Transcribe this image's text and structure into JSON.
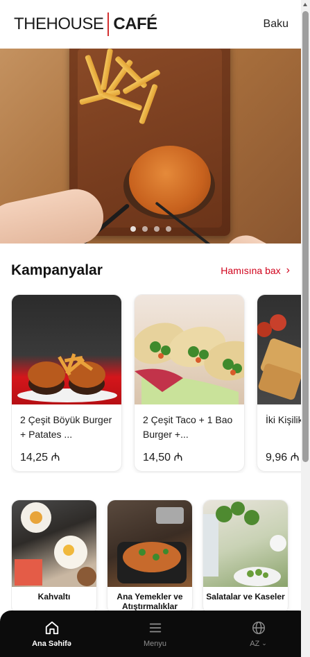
{
  "header": {
    "logo_part1": "THEHOUSE",
    "logo_part2": "CAFÉ",
    "city": "Baku"
  },
  "hero": {
    "slides": 4,
    "active_slide": 1
  },
  "campaigns": {
    "title": "Kampanyalar",
    "see_all": "Hamısına bax",
    "items": [
      {
        "name": "2 Çeşit Böyük Burger + Patates ...",
        "price": "14,25 ₼"
      },
      {
        "name": "2 Çeşit Taco + 1 Bao Burger +...",
        "price": "14,50 ₼"
      },
      {
        "name": "İki Kişilik Tabağı",
        "price": "9,96 ₼"
      }
    ]
  },
  "categories": [
    {
      "label": "Kahvaltı"
    },
    {
      "label": "Ana Yemekler ve Atıştırmalıklar"
    },
    {
      "label": "Salatalar ve Kaseler"
    }
  ],
  "nav": {
    "home": "Ana Səhifə",
    "menu": "Menyu",
    "lang": "AZ"
  },
  "colors": {
    "accent": "#d0021b",
    "nav_bg": "#0c0c0c"
  }
}
